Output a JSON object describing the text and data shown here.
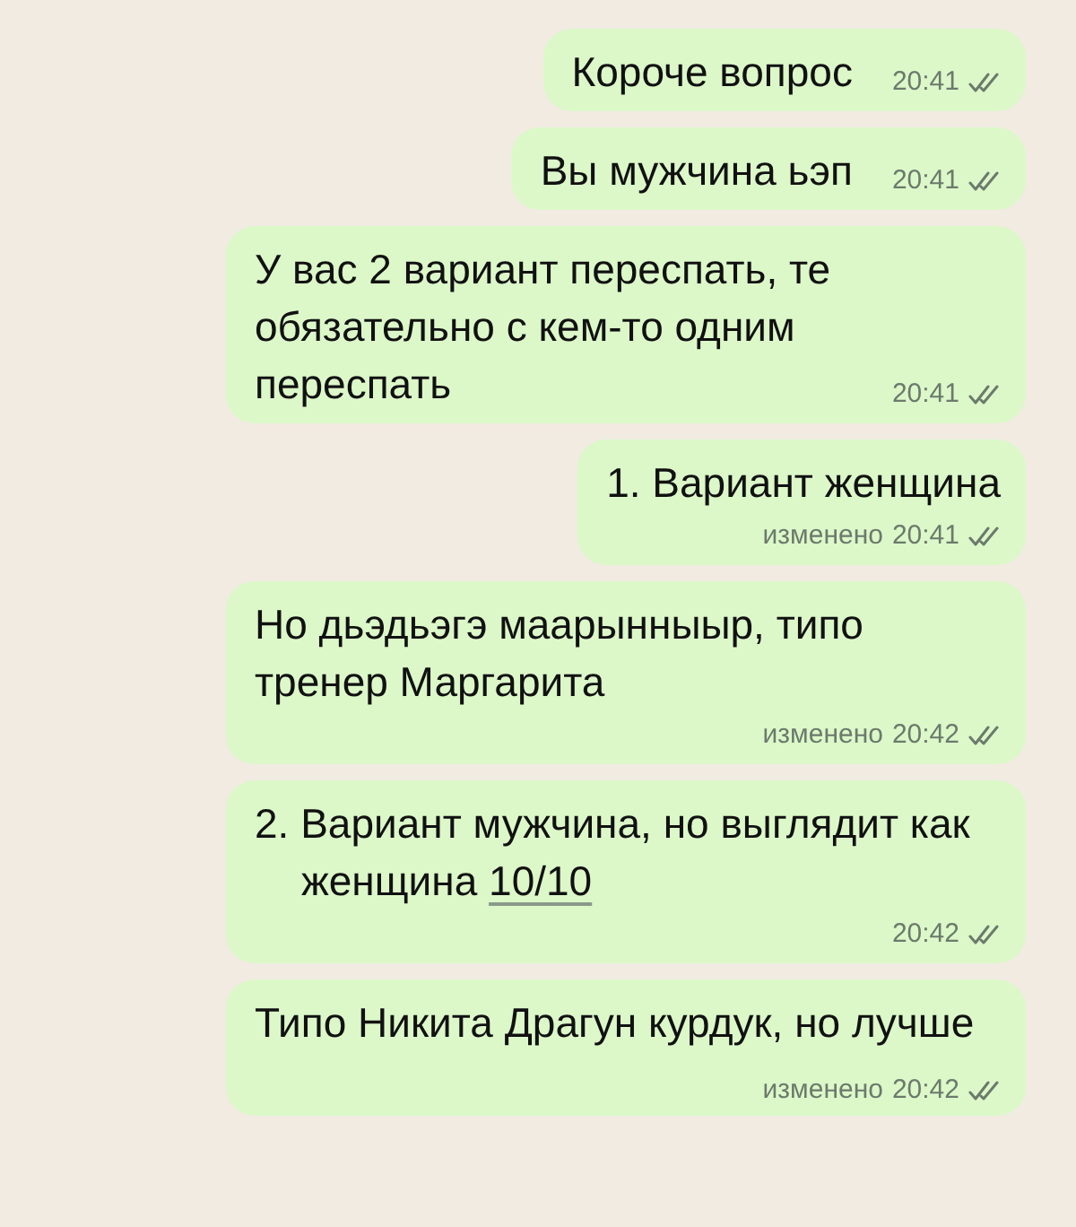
{
  "messages": [
    {
      "kind": "inline",
      "list": false,
      "text": "Короче вопрос",
      "time": "20:41"
    },
    {
      "kind": "inline",
      "list": false,
      "text": "Вы мужчина ьэп",
      "time": "20:41"
    },
    {
      "kind": "inline",
      "list": false,
      "text": "У вас 2 вариант переспать, те обязательно с кем-то одним переспать",
      "time": "20:41"
    },
    {
      "kind": "below",
      "list": true,
      "text": "1. Вариант женщина",
      "edited": "изменено",
      "time": "20:41"
    },
    {
      "kind": "below",
      "list": false,
      "text": "Но дьэдьэгэ маарынныыр, типо тренер Маргарита",
      "edited": "изменено",
      "time": "20:42"
    },
    {
      "kind": "below",
      "list": true,
      "text": "2. Вариант мужчина, но выглядит как женщина",
      "link": "10/10",
      "time": "20:42"
    },
    {
      "kind": "inline",
      "list": false,
      "text": "Типо Никита Драгун курдук, но лучше",
      "edited": "изменено",
      "time": "20:42"
    }
  ]
}
